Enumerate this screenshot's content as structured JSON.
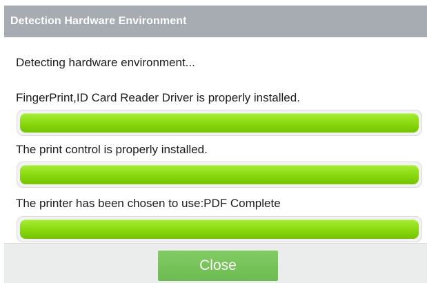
{
  "dialog": {
    "title": "Detection Hardware Environment",
    "status_text": "Detecting hardware environment...",
    "checks": [
      {
        "message": "FingerPrint,ID Card Reader Driver is properly installed.",
        "progress": 1.0
      },
      {
        "message": "The print control is properly installed.",
        "progress": 1.0
      },
      {
        "message": "The printer has been chosen to use:PDF Complete",
        "progress": 1.0
      }
    ],
    "close_label": "Close"
  },
  "colors": {
    "title_bar": "#a6acb1",
    "progress_fill": "#8ddc13",
    "close_button": "#75c25a",
    "footer": "#ebecec"
  }
}
